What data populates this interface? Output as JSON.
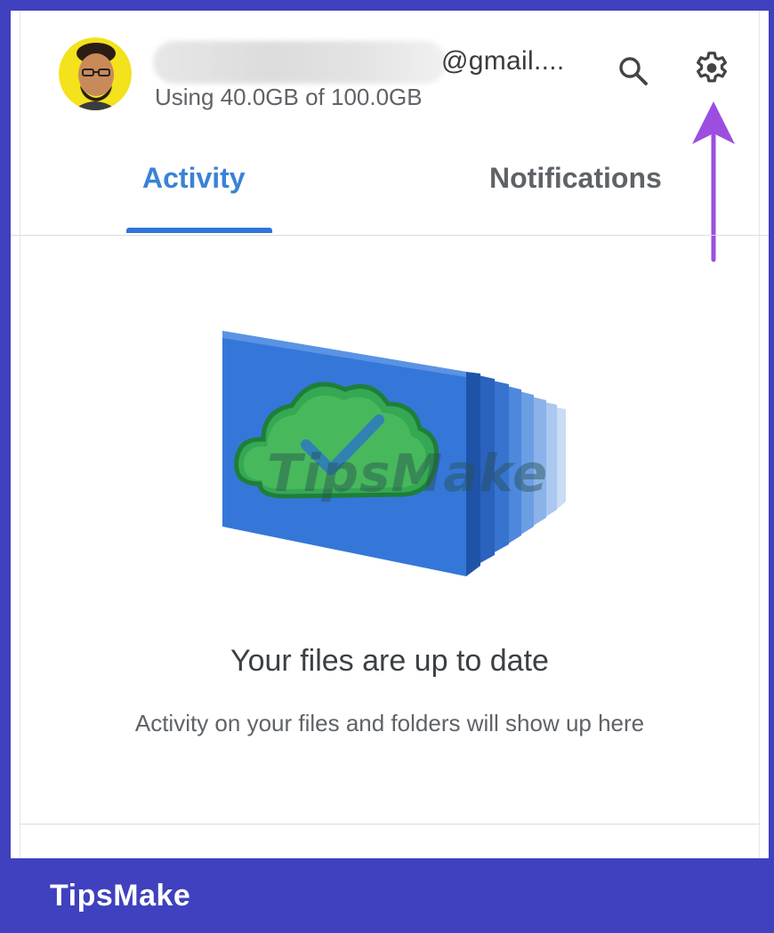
{
  "header": {
    "email_suffix": "@gmail....",
    "storage_text": "Using 40.0GB of 100.0GB",
    "icons": {
      "search": "search-icon",
      "settings": "gear-icon",
      "annotation": "arrow-up-icon"
    }
  },
  "tabs": [
    {
      "label": "Activity",
      "active": true
    },
    {
      "label": "Notifications",
      "active": false
    }
  ],
  "empty_state": {
    "title": "Your files are up to date",
    "subtitle": "Activity on your files and folders will show up here"
  },
  "watermark": "TipsMake",
  "footer": {
    "brand": "TipsMake"
  },
  "colors": {
    "frame": "#3f41be",
    "accent_tab": "#3b82d6",
    "annotation_arrow": "#9b4ee0"
  }
}
